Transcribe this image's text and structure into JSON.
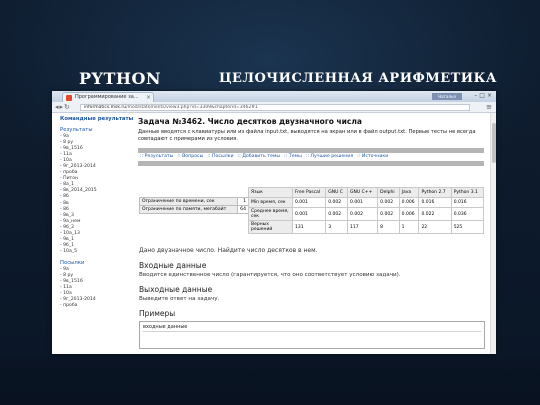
{
  "slide": {
    "title_left": "PYTHON",
    "title_right": "ЦЕЛОЧИСЛЕННАЯ АРИФМЕТИКА"
  },
  "browser": {
    "tab_title": "Программирование за...",
    "user_label": "Наталья",
    "url_host": "informatics.msk.ru",
    "url_path": "/mod/statements/view3.php?id=3309&chapterid=3462#1"
  },
  "sidebar": {
    "header": "Командные результаты",
    "results_title": "Результаты",
    "results_items": [
      "- 9а",
      "- 8 ру",
      "- 9в_1516",
      "- 11а",
      "- 10а",
      "- 9г_2013-2014",
      "- проба",
      "- Питон",
      "- 8а_1",
      "- 8в_2014_2015",
      "- 8б",
      "- 8в",
      "- 8б",
      "- 8в_3",
      "- 9а_нем",
      "- 9б_2",
      "- 10а_13",
      "- 9в_1",
      "- 9б_1",
      "- 10а_5"
    ],
    "posts_title": "Посылки",
    "posts_items": [
      "- 9а",
      "- 8 ру",
      "- 9в_1516",
      "- 11а",
      "- 10а",
      "- 9г_2013-2014",
      "- проба"
    ]
  },
  "main": {
    "task_title": "Задача №3462. Число десятков двузначного числа",
    "task_desc": "Данные вводятся с клавиатуры или из файла input.txt, выводятся на экран или в файл output.txt. Первые тесты не всегда совпадают с примерами из условия.",
    "links": [
      ":: Результаты",
      ":: Вопросы",
      ":: Посылки",
      ":: Добавить темы",
      ":: Темы",
      ":: Лучшие решения",
      ":: Источники"
    ],
    "limits": {
      "time_label": "Ограничение по времени, сек",
      "time_value": "1",
      "memory_label": "Ограничение по памяти, мегабайт",
      "memory_value": "64"
    },
    "lang_table": {
      "header": [
        "Язык",
        "Free Pascal",
        "GNU C",
        "GNU C++",
        "Delphi",
        "Java",
        "Python 2.7",
        "Python 3.1"
      ],
      "rows": [
        [
          "Min время, сек",
          "0.001",
          "0.002",
          "0.001",
          "0.002",
          "0.006",
          "0.016",
          "0.016"
        ],
        [
          "Среднее время, сек",
          "0.001",
          "0.002",
          "0.002",
          "0.002",
          "0.006",
          "0.022",
          "0.036"
        ],
        [
          "Верных решений",
          "131",
          "3",
          "117",
          "8",
          "1",
          "22",
          "525"
        ]
      ]
    },
    "statement": "Дано двузначное число. Найдите число десятков в нем.",
    "input_heading": "Входные данные",
    "input_text": "Вводится единственное число (гарантируется, что оно соответствует условию задачи).",
    "output_heading": "Выходные данные",
    "output_text": "Выведите ответ на задачу.",
    "examples_heading": "Примеры",
    "example_input_label": "входные данные"
  }
}
